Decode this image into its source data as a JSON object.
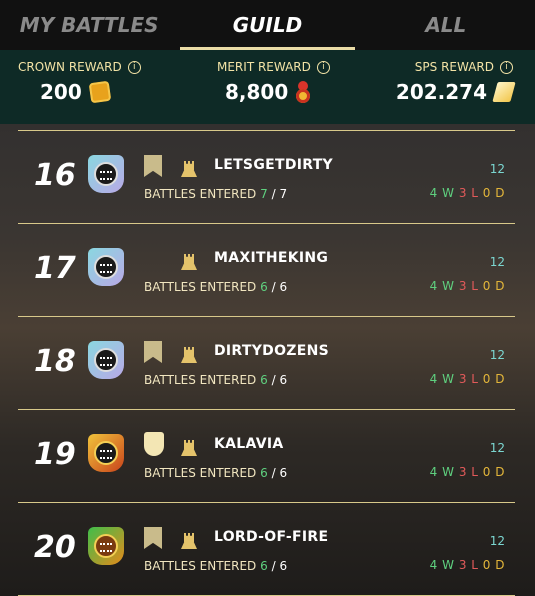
{
  "tabs": [
    {
      "label": "MY BATTLES",
      "active": false
    },
    {
      "label": "GUILD",
      "active": true
    },
    {
      "label": "ALL",
      "active": false
    }
  ],
  "rewards": {
    "crown": {
      "label": "CROWN REWARD",
      "value": "200",
      "icon": "crown-token-icon"
    },
    "merit": {
      "label": "MERIT REWARD",
      "value": "8,800",
      "icon": "merit-medal-icon"
    },
    "sps": {
      "label": "SPS REWARD",
      "value": "202.274",
      "icon": "sps-token-icon"
    }
  },
  "entered_label": "BATTLES ENTERED",
  "guilds": [
    {
      "rank": "16",
      "name": "LETSGETDIRTY",
      "entered": "7",
      "total": "7",
      "score": "12",
      "w": "4 W",
      "l": "3 L",
      "d": "0 D",
      "badge": "banner",
      "emblem": "teal"
    },
    {
      "rank": "17",
      "name": "MAXITHEKING",
      "entered": "6",
      "total": "6",
      "score": "12",
      "w": "4 W",
      "l": "3 L",
      "d": "0 D",
      "badge": "none",
      "emblem": "teal"
    },
    {
      "rank": "18",
      "name": "DIRTYDOZENS",
      "entered": "6",
      "total": "6",
      "score": "12",
      "w": "4 W",
      "l": "3 L",
      "d": "0 D",
      "badge": "banner",
      "emblem": "teal"
    },
    {
      "rank": "19",
      "name": "KALAVIA",
      "entered": "6",
      "total": "6",
      "score": "12",
      "w": "4 W",
      "l": "3 L",
      "d": "0 D",
      "badge": "crest",
      "emblem": "gold"
    },
    {
      "rank": "20",
      "name": "LORD-OF-FIRE",
      "entered": "6",
      "total": "6",
      "score": "12",
      "w": "4 W",
      "l": "3 L",
      "d": "0 D",
      "badge": "banner",
      "emblem": "fire"
    }
  ],
  "colors": {
    "accent": "#e9dca6",
    "win": "#5fd07f",
    "loss": "#e25a5a",
    "draw": "#e3b63a",
    "rewards_bg": "#0e2a26"
  }
}
